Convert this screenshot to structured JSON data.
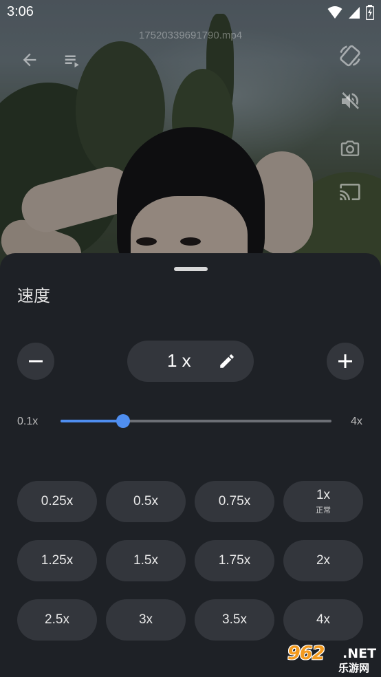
{
  "status_bar": {
    "time": "3:06"
  },
  "player": {
    "filename": "17520339691790.mp4"
  },
  "speed_sheet": {
    "title": "速度",
    "current_speed": "1 x",
    "slider": {
      "min_label": "0.1x",
      "max_label": "4x",
      "value": 1.0,
      "min": 0.1,
      "max": 4.0
    },
    "presets": [
      {
        "label": "0.25x"
      },
      {
        "label": "0.5x"
      },
      {
        "label": "0.75x"
      },
      {
        "label": "1x",
        "sub": "正常"
      },
      {
        "label": "1.25x"
      },
      {
        "label": "1.5x"
      },
      {
        "label": "1.75x"
      },
      {
        "label": "2x"
      },
      {
        "label": "2.5x"
      },
      {
        "label": "3x"
      },
      {
        "label": "3.5x"
      },
      {
        "label": "4x"
      }
    ]
  },
  "watermark": {
    "main": "962",
    "net": ".NET",
    "sub": "乐游网"
  },
  "colors": {
    "accent": "#4f8ef0",
    "sheet_bg": "#1e2126",
    "chip_bg": "#33363c"
  }
}
